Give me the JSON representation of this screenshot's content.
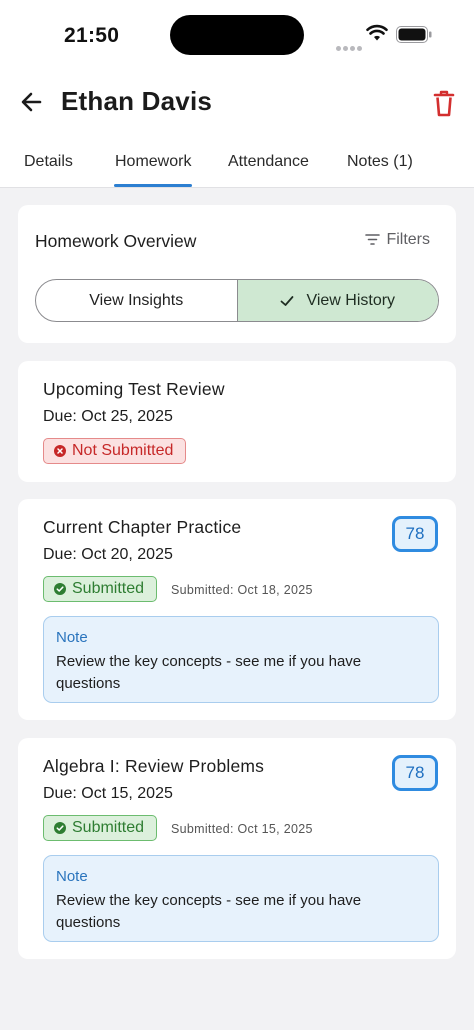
{
  "status_bar": {
    "time": "21:50"
  },
  "header": {
    "title": "Ethan Davis"
  },
  "tabs": [
    {
      "label": "Details",
      "active": false
    },
    {
      "label": "Homework",
      "active": true
    },
    {
      "label": "Attendance",
      "active": false
    },
    {
      "label": "Notes (1)",
      "active": false
    }
  ],
  "overview": {
    "title": "Homework Overview",
    "filters_label": "Filters",
    "segments": [
      {
        "label": "View Insights",
        "active": false
      },
      {
        "label": "View History",
        "active": true
      }
    ]
  },
  "homework": [
    {
      "title": "Upcoming Test Review",
      "due": "Due: Oct 25, 2025",
      "status": "Not Submitted"
    },
    {
      "title": "Current Chapter Practice",
      "due": "Due: Oct 20, 2025",
      "status": "Submitted",
      "submitted_at": "Submitted: Oct 18, 2025",
      "score": "78",
      "note_label": "Note",
      "note_text": "Review the key concepts - see me if you have questions"
    },
    {
      "title": "Algebra I: Review Problems",
      "due": "Due: Oct 15, 2025",
      "status": "Submitted",
      "submitted_at": "Submitted: Oct 15, 2025",
      "score": "78",
      "note_label": "Note",
      "note_text": "Review the key concepts - see me if you have questions"
    }
  ],
  "colors": {
    "accent": "#2c7fd1",
    "danger": "#d32f2f",
    "success": "#2e7d32",
    "segment_active": "#cfe8d2"
  }
}
